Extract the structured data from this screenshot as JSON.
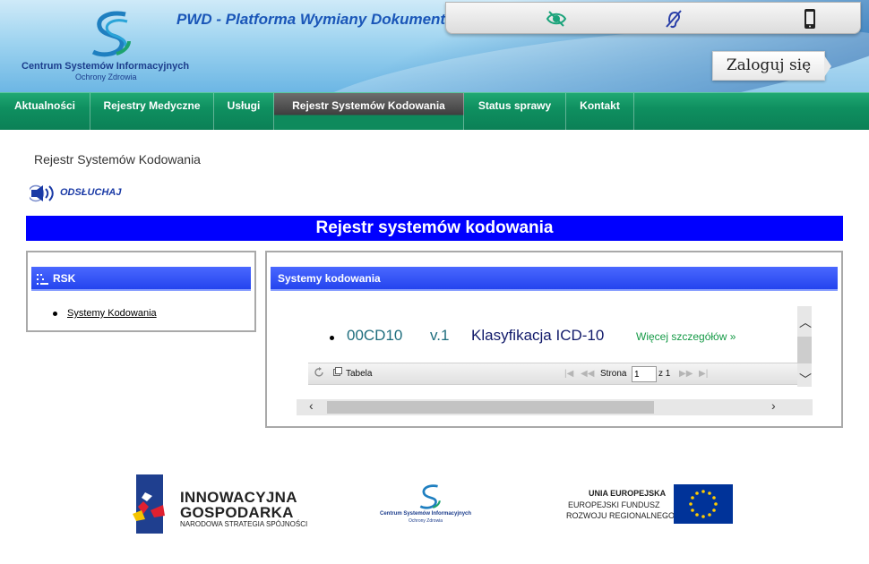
{
  "header": {
    "site_title": "PWD - Platforma Wymiany Dokumentów",
    "logo_name": "Centrum Systemów Informacyjnych",
    "logo_sub": "Ochrony Zdrowia",
    "accessibility_icons": [
      "eye-contrast-icon",
      "hearing-impaired-icon",
      "mobile-phone-icon"
    ],
    "login_label": "Zaloguj się"
  },
  "nav": {
    "items": [
      {
        "label": "Aktualności"
      },
      {
        "label": "Rejestry Medyczne"
      },
      {
        "label": "Usługi"
      },
      {
        "label": "Rejestr Systemów Kodowania",
        "active": true
      },
      {
        "label": "Status sprawy"
      },
      {
        "label": "Kontakt"
      }
    ]
  },
  "breadcrumb": "Rejestr Systemów Kodowania",
  "listen_label": "ODSŁUCHAJ",
  "page_heading": "Rejestr systemów kodowania",
  "left_panel": {
    "title": "RSK",
    "links": [
      "Systemy Kodowania"
    ]
  },
  "right_panel": {
    "title": "Systemy kodowania",
    "records": [
      {
        "code": "00CD10",
        "version": "v.1",
        "name": "Klasyfikacja ICD-10",
        "more": "Więcej szczegółów »"
      }
    ],
    "pager": {
      "view_label": "Tabela",
      "page_label": "Strona",
      "page_value": "1",
      "of_label": "z 1"
    }
  },
  "footer": {
    "ig_line1": "INNOWACYJNA",
    "ig_line2": "GOSPODARKA",
    "ig_line3": "NARODOWA STRATEGIA SPÓJNOŚCI",
    "csi_name": "Centrum Systemów Informacyjnych",
    "csi_sub": "Ochrony Zdrowia",
    "eu_line1": "UNIA EUROPEJSKA",
    "eu_line2": "EUROPEJSKI FUNDUSZ",
    "eu_line3": "ROZWOJU REGIONALNEGO"
  },
  "colors": {
    "nav_green": "#0f9060",
    "heading_blue": "#0000ff",
    "panel_head_blue": "#2444ee",
    "link_green": "#159a46",
    "eu_blue": "#003399"
  }
}
